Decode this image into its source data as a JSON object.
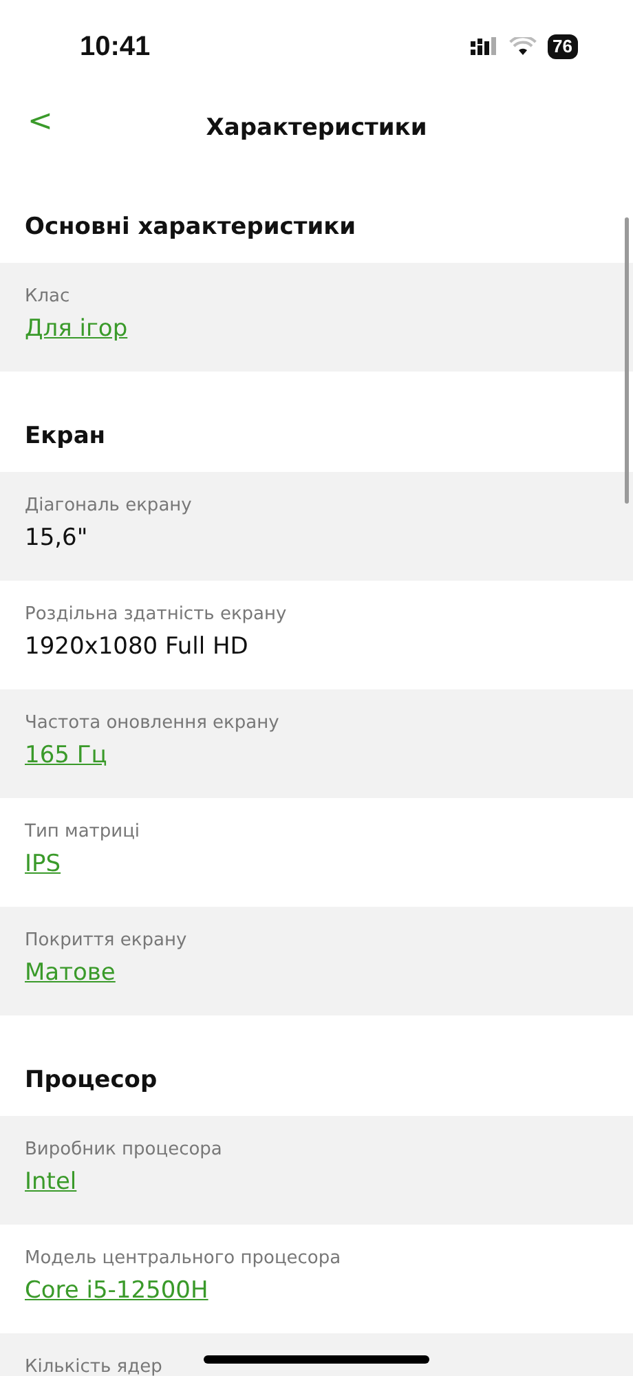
{
  "status_bar": {
    "time": "10:41",
    "battery": "76"
  },
  "nav": {
    "back": "<",
    "title": "Характеристики"
  },
  "sections": [
    {
      "title": "Основні характеристики",
      "rows": [
        {
          "label": "Клас",
          "value": "Для ігор",
          "kind": "link"
        }
      ]
    },
    {
      "title": "Екран",
      "rows": [
        {
          "label": "Діагональ екрану",
          "value": "15,6\"",
          "kind": "text"
        },
        {
          "label": "Роздільна здатність екрану",
          "value": "1920x1080 Full HD",
          "kind": "text"
        },
        {
          "label": "Частота оновлення екрану",
          "value": "165 Гц",
          "kind": "link"
        },
        {
          "label": "Тип матриці",
          "value": "IPS",
          "kind": "link"
        },
        {
          "label": "Покриття екрану",
          "value": "Матове",
          "kind": "link"
        }
      ]
    },
    {
      "title": "Процесор",
      "rows": [
        {
          "label": "Виробник процесора",
          "value": "Intel",
          "kind": "link"
        },
        {
          "label": "Модель центрального процесора",
          "value": "Core i5-12500H",
          "kind": "link"
        },
        {
          "label": "Кількість ядер"
        }
      ]
    }
  ]
}
